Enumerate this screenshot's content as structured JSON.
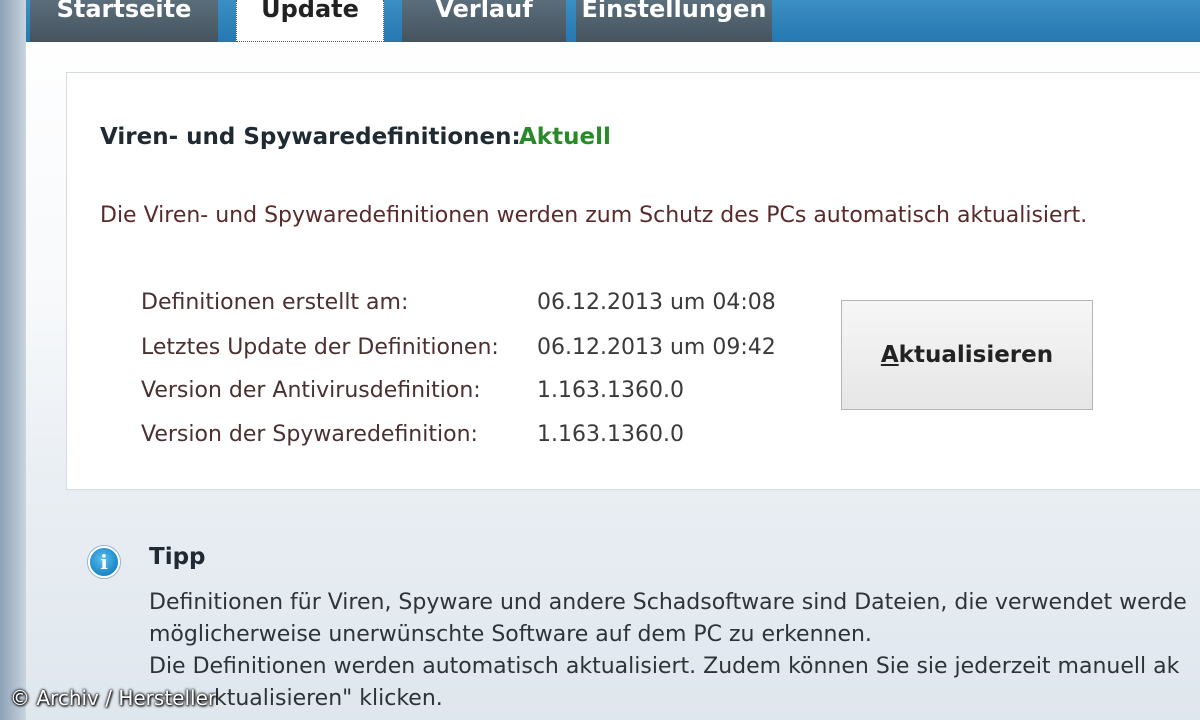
{
  "tabs": [
    {
      "label": "Startseite"
    },
    {
      "label": "Update"
    },
    {
      "label": "Verlauf"
    },
    {
      "label": "Einstellungen"
    }
  ],
  "status": {
    "label": "Viren- und Spywaredefinitionen:",
    "value": "Aktuell",
    "value_color": "#2a8a2a",
    "description": "Die Viren- und Spywaredefinitionen werden zum Schutz des PCs automatisch aktualisiert."
  },
  "info": [
    {
      "label": "Definitionen erstellt am:",
      "value": "06.12.2013 um 04:08"
    },
    {
      "label": "Letztes Update der Definitionen:",
      "value": "06.12.2013 um 09:42"
    },
    {
      "label": "Version der Antivirusdefinition:",
      "value": "1.163.1360.0"
    },
    {
      "label": "Version der Spywaredefinition:",
      "value": "1.163.1360.0"
    }
  ],
  "update_button": {
    "accel": "A",
    "rest": "ktualisieren"
  },
  "tip": {
    "icon": "info-icon",
    "title": "Tipp",
    "lines": [
      "Definitionen für Viren, Spyware und andere Schadsoftware sind Dateien, die verwendet werde",
      "möglicherweise unerwünschte Software auf dem PC zu erkennen.",
      "Die Definitionen werden automatisch aktualisiert. Zudem können Sie sie jederzeit manuell ak",
      "ktualisieren\" klicken."
    ]
  },
  "watermark": "© Archiv / Hersteller",
  "colors": {
    "accent_blue": "#2678b0",
    "tab_dark": "#45535e",
    "status_green": "#2a8a2a"
  }
}
